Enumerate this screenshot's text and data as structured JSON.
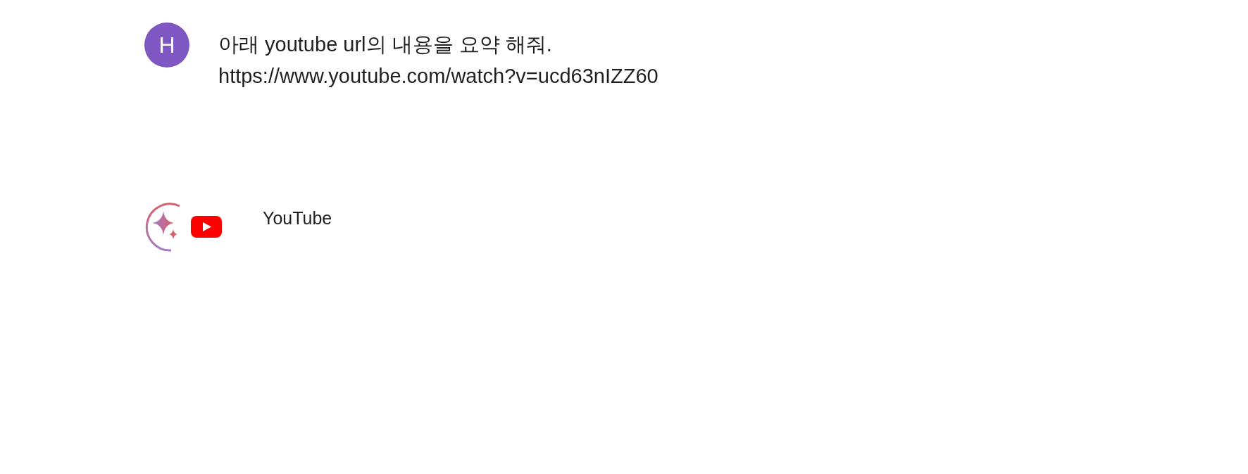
{
  "user_message": {
    "avatar": "H",
    "lines": [
      "아래 youtube url의 내용을 요약 해줘.",
      "https://www.youtube.com/watch?v=ucd63nIZZ60"
    ]
  },
  "response": {
    "extension": "YouTube"
  }
}
